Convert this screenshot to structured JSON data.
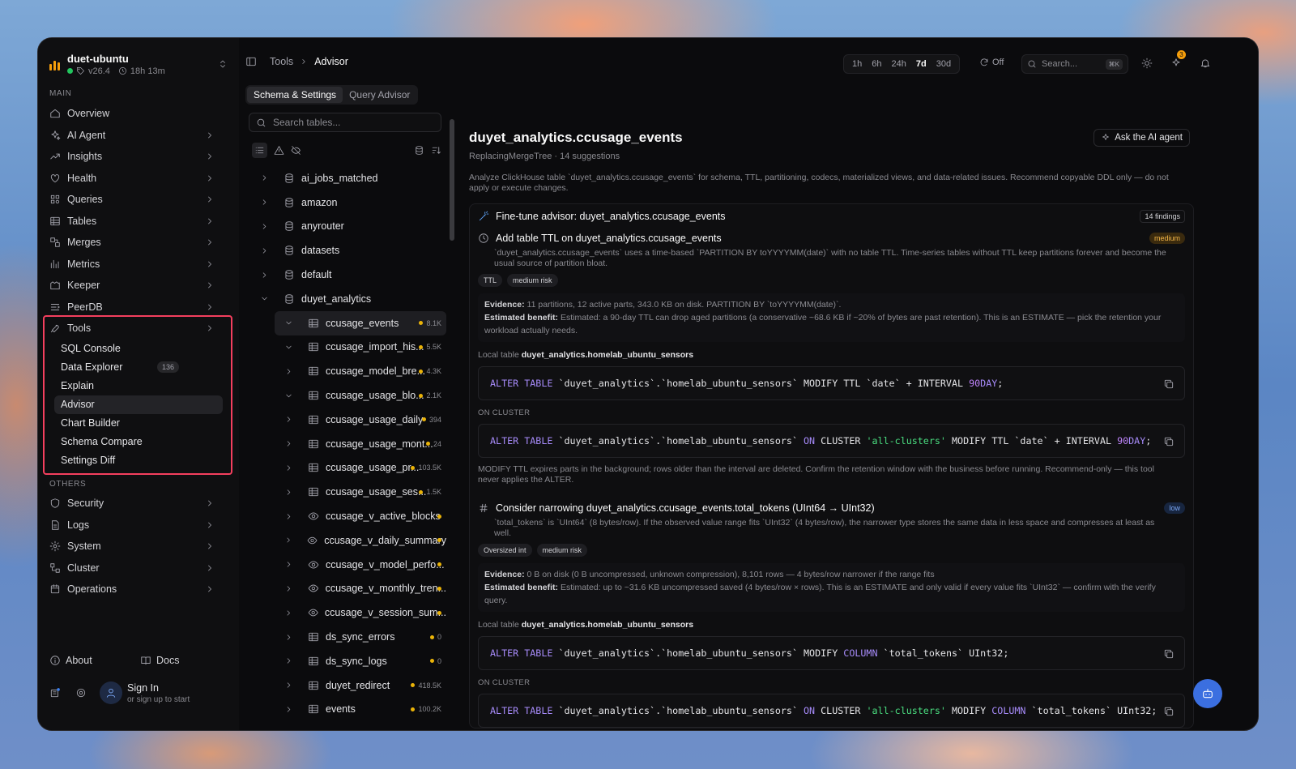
{
  "brand": {
    "name": "duet-ubuntu",
    "version": "v26.4",
    "uptime": "18h 13m"
  },
  "sidebar": {
    "main_label": "MAIN",
    "items": [
      {
        "label": "Overview",
        "icon": "home-icon"
      },
      {
        "label": "AI Agent",
        "icon": "sparkles-icon"
      },
      {
        "label": "Insights",
        "icon": "trend-icon"
      },
      {
        "label": "Health",
        "icon": "heart-icon"
      },
      {
        "label": "Queries",
        "icon": "grid-icon"
      },
      {
        "label": "Tables",
        "icon": "table-icon"
      },
      {
        "label": "Merges",
        "icon": "merge-icon"
      },
      {
        "label": "Metrics",
        "icon": "bar-chart-icon"
      },
      {
        "label": "Keeper",
        "icon": "keeper-icon"
      },
      {
        "label": "PeerDB",
        "icon": "peerdb-icon"
      }
    ],
    "tools_label": "Tools",
    "tools_sub": [
      {
        "label": "SQL Console"
      },
      {
        "label": "Data Explorer",
        "badge": "136"
      },
      {
        "label": "Explain"
      },
      {
        "label": "Advisor"
      },
      {
        "label": "Chart Builder"
      },
      {
        "label": "Schema Compare"
      },
      {
        "label": "Settings Diff"
      }
    ],
    "others_label": "OTHERS",
    "others": [
      {
        "label": "Security"
      },
      {
        "label": "Logs"
      },
      {
        "label": "System"
      },
      {
        "label": "Cluster"
      },
      {
        "label": "Operations"
      }
    ],
    "about": "About",
    "docs": "Docs",
    "sign_in": "Sign In",
    "sign_in_sub": "or sign up to start"
  },
  "topbar": {
    "crumb_parent": "Tools",
    "crumb_current": "Advisor",
    "ranges": [
      "1h",
      "6h",
      "24h",
      "7d",
      "30d"
    ],
    "selected_range": "7d",
    "refresh": "Off",
    "search_placeholder": "Search...",
    "search_kbd": "⌘K",
    "notif_count": "3"
  },
  "tabs": [
    "Schema & Settings",
    "Query Advisor"
  ],
  "table_panel": {
    "search_placeholder": "Search tables...",
    "databases": [
      "ai_jobs_matched",
      "amazon",
      "anyrouter",
      "datasets",
      "default",
      "duyet_analytics"
    ],
    "tables": [
      {
        "name": "ccusage_events",
        "size": "8.1K"
      },
      {
        "name": "ccusage_import_his...",
        "size": "5.5K"
      },
      {
        "name": "ccusage_model_bre...",
        "size": "4.3K"
      },
      {
        "name": "ccusage_usage_blo...",
        "size": "2.1K"
      },
      {
        "name": "ccusage_usage_daily",
        "size": "394"
      },
      {
        "name": "ccusage_usage_mont...",
        "size": "24"
      },
      {
        "name": "ccusage_usage_pr...",
        "size": "103.5K"
      },
      {
        "name": "ccusage_usage_ses...",
        "size": "1.5K"
      },
      {
        "name": "ccusage_v_active_blocks",
        "size": ""
      },
      {
        "name": "ccusage_v_daily_summary",
        "size": ""
      },
      {
        "name": "ccusage_v_model_perfo...",
        "size": ""
      },
      {
        "name": "ccusage_v_monthly_tren...",
        "size": ""
      },
      {
        "name": "ccusage_v_session_sum...",
        "size": ""
      },
      {
        "name": "ds_sync_errors",
        "size": "0"
      },
      {
        "name": "ds_sync_logs",
        "size": "0"
      },
      {
        "name": "duyet_redirect",
        "size": "418.5K"
      },
      {
        "name": "events",
        "size": "100.2K"
      }
    ]
  },
  "content": {
    "title": "duyet_analytics.ccusage_events",
    "subtitle": "ReplacingMergeTree · 14 suggestions",
    "ask_button": "Ask the AI agent",
    "description": "Analyze ClickHouse table `duyet_analytics.ccusage_events` for schema, TTL, partitioning, codecs, materialized views, and data-related issues. Recommend copyable DDL only — do not apply or execute changes.",
    "card_title": "Fine-tune advisor: duyet_analytics.ccusage_events",
    "findings_count": "14 findings",
    "f1": {
      "title": "Add table TTL on duyet_analytics.ccusage_events",
      "severity": "medium",
      "desc": "`duyet_analytics.ccusage_events` uses a time-based `PARTITION BY toYYYYMM(date)` with no table TTL. Time-series tables without TTL keep partitions forever and become the usual source of partition bloat.",
      "tags": [
        "TTL",
        "medium risk"
      ],
      "evidence_label": "Evidence:",
      "evidence": "11 partitions, 12 active parts, 343.0 KB on disk. PARTITION BY `toYYYYMM(date)`.",
      "benefit_label": "Estimated benefit:",
      "benefit": "Estimated: a 90-day TTL can drop aged partitions (a conservative ~68.6 KB if ~20% of bytes are past retention). This is an ESTIMATE — pick the retention your workload actually needs.",
      "local_label": "Local table",
      "local_table": "duyet_analytics.homelab_ubuntu_sensors",
      "on_cluster": "ON CLUSTER",
      "note": "MODIFY TTL expires parts in the background; rows older than the interval are deleted. Confirm the retention window with the business before running. Recommend-only — this tool never applies the ALTER."
    },
    "f2": {
      "title": "Consider narrowing duyet_analytics.ccusage_events.total_tokens (UInt64 → UInt32)",
      "severity": "low",
      "desc": "`total_tokens` is `UInt64` (8 bytes/row). If the observed value range fits `UInt32` (4 bytes/row), the narrower type stores the same data in less space and compresses at least as well.",
      "tags": [
        "Oversized int",
        "medium risk"
      ],
      "evidence_label": "Evidence:",
      "evidence": "0 B on disk (0 B uncompressed, unknown compression), 8,101 rows — 4 bytes/row narrower if the range fits",
      "benefit_label": "Estimated benefit:",
      "benefit": "Estimated: up to ~31.6 KB uncompressed saved (4 bytes/row × rows). This is an ESTIMATE and only valid if every value fits `UInt32` — confirm with the verify query.",
      "local_label": "Local table",
      "local_table": "duyet_analytics.homelab_ubuntu_sensors",
      "on_cluster": "ON CLUSTER"
    }
  }
}
